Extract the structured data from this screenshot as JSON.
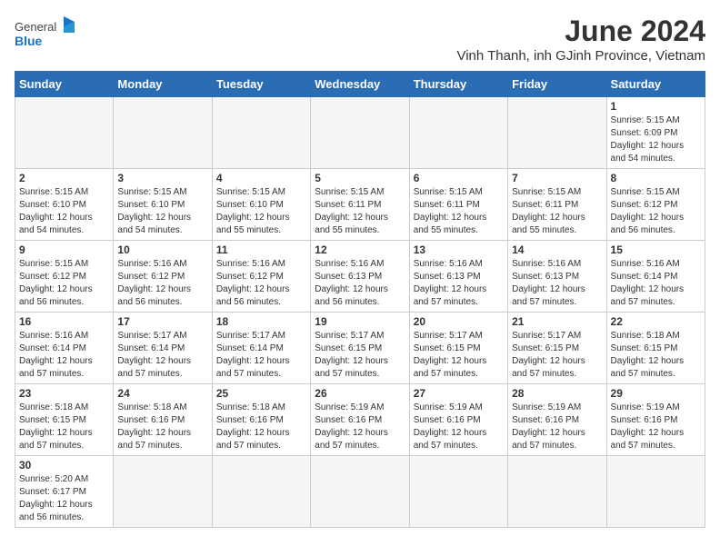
{
  "header": {
    "logo_general": "General",
    "logo_blue": "Blue",
    "month_title": "June 2024",
    "location": "Vinh Thanh, inh GJinh Province, Vietnam"
  },
  "weekdays": [
    "Sunday",
    "Monday",
    "Tuesday",
    "Wednesday",
    "Thursday",
    "Friday",
    "Saturday"
  ],
  "weeks": [
    [
      {
        "day": "",
        "info": ""
      },
      {
        "day": "",
        "info": ""
      },
      {
        "day": "",
        "info": ""
      },
      {
        "day": "",
        "info": ""
      },
      {
        "day": "",
        "info": ""
      },
      {
        "day": "",
        "info": ""
      },
      {
        "day": "1",
        "info": "Sunrise: 5:15 AM\nSunset: 6:09 PM\nDaylight: 12 hours and 54 minutes."
      }
    ],
    [
      {
        "day": "2",
        "info": "Sunrise: 5:15 AM\nSunset: 6:10 PM\nDaylight: 12 hours and 54 minutes."
      },
      {
        "day": "3",
        "info": "Sunrise: 5:15 AM\nSunset: 6:10 PM\nDaylight: 12 hours and 54 minutes."
      },
      {
        "day": "4",
        "info": "Sunrise: 5:15 AM\nSunset: 6:10 PM\nDaylight: 12 hours and 55 minutes."
      },
      {
        "day": "5",
        "info": "Sunrise: 5:15 AM\nSunset: 6:11 PM\nDaylight: 12 hours and 55 minutes."
      },
      {
        "day": "6",
        "info": "Sunrise: 5:15 AM\nSunset: 6:11 PM\nDaylight: 12 hours and 55 minutes."
      },
      {
        "day": "7",
        "info": "Sunrise: 5:15 AM\nSunset: 6:11 PM\nDaylight: 12 hours and 55 minutes."
      },
      {
        "day": "8",
        "info": "Sunrise: 5:15 AM\nSunset: 6:12 PM\nDaylight: 12 hours and 56 minutes."
      }
    ],
    [
      {
        "day": "9",
        "info": "Sunrise: 5:15 AM\nSunset: 6:12 PM\nDaylight: 12 hours and 56 minutes."
      },
      {
        "day": "10",
        "info": "Sunrise: 5:16 AM\nSunset: 6:12 PM\nDaylight: 12 hours and 56 minutes."
      },
      {
        "day": "11",
        "info": "Sunrise: 5:16 AM\nSunset: 6:12 PM\nDaylight: 12 hours and 56 minutes."
      },
      {
        "day": "12",
        "info": "Sunrise: 5:16 AM\nSunset: 6:13 PM\nDaylight: 12 hours and 56 minutes."
      },
      {
        "day": "13",
        "info": "Sunrise: 5:16 AM\nSunset: 6:13 PM\nDaylight: 12 hours and 57 minutes."
      },
      {
        "day": "14",
        "info": "Sunrise: 5:16 AM\nSunset: 6:13 PM\nDaylight: 12 hours and 57 minutes."
      },
      {
        "day": "15",
        "info": "Sunrise: 5:16 AM\nSunset: 6:14 PM\nDaylight: 12 hours and 57 minutes."
      }
    ],
    [
      {
        "day": "16",
        "info": "Sunrise: 5:16 AM\nSunset: 6:14 PM\nDaylight: 12 hours and 57 minutes."
      },
      {
        "day": "17",
        "info": "Sunrise: 5:17 AM\nSunset: 6:14 PM\nDaylight: 12 hours and 57 minutes."
      },
      {
        "day": "18",
        "info": "Sunrise: 5:17 AM\nSunset: 6:14 PM\nDaylight: 12 hours and 57 minutes."
      },
      {
        "day": "19",
        "info": "Sunrise: 5:17 AM\nSunset: 6:15 PM\nDaylight: 12 hours and 57 minutes."
      },
      {
        "day": "20",
        "info": "Sunrise: 5:17 AM\nSunset: 6:15 PM\nDaylight: 12 hours and 57 minutes."
      },
      {
        "day": "21",
        "info": "Sunrise: 5:17 AM\nSunset: 6:15 PM\nDaylight: 12 hours and 57 minutes."
      },
      {
        "day": "22",
        "info": "Sunrise: 5:18 AM\nSunset: 6:15 PM\nDaylight: 12 hours and 57 minutes."
      }
    ],
    [
      {
        "day": "23",
        "info": "Sunrise: 5:18 AM\nSunset: 6:15 PM\nDaylight: 12 hours and 57 minutes."
      },
      {
        "day": "24",
        "info": "Sunrise: 5:18 AM\nSunset: 6:16 PM\nDaylight: 12 hours and 57 minutes."
      },
      {
        "day": "25",
        "info": "Sunrise: 5:18 AM\nSunset: 6:16 PM\nDaylight: 12 hours and 57 minutes."
      },
      {
        "day": "26",
        "info": "Sunrise: 5:19 AM\nSunset: 6:16 PM\nDaylight: 12 hours and 57 minutes."
      },
      {
        "day": "27",
        "info": "Sunrise: 5:19 AM\nSunset: 6:16 PM\nDaylight: 12 hours and 57 minutes."
      },
      {
        "day": "28",
        "info": "Sunrise: 5:19 AM\nSunset: 6:16 PM\nDaylight: 12 hours and 57 minutes."
      },
      {
        "day": "29",
        "info": "Sunrise: 5:19 AM\nSunset: 6:16 PM\nDaylight: 12 hours and 57 minutes."
      }
    ],
    [
      {
        "day": "30",
        "info": "Sunrise: 5:20 AM\nSunset: 6:17 PM\nDaylight: 12 hours and 56 minutes."
      },
      {
        "day": "",
        "info": ""
      },
      {
        "day": "",
        "info": ""
      },
      {
        "day": "",
        "info": ""
      },
      {
        "day": "",
        "info": ""
      },
      {
        "day": "",
        "info": ""
      },
      {
        "day": "",
        "info": ""
      }
    ]
  ]
}
